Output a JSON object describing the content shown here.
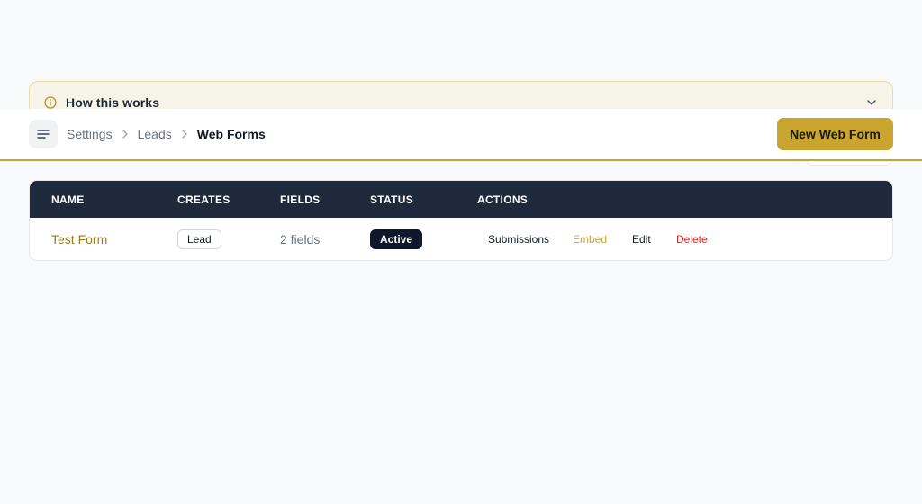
{
  "info_panel": {
    "title": "How this works",
    "icon": "info-icon",
    "chevron": "chevron-down-icon"
  },
  "header": {
    "menu_icon": "menu-icon",
    "breadcrumb": [
      {
        "label": "Settings"
      },
      {
        "label": "Leads"
      },
      {
        "label": "Web Forms"
      }
    ],
    "new_button_label": "New Web Form"
  },
  "table": {
    "columns": [
      "NAME",
      "CREATES",
      "FIELDS",
      "STATUS",
      "ACTIONS"
    ],
    "rows": [
      {
        "name": "Test Form",
        "creates": "Lead",
        "fields": "2 fields",
        "status": "Active",
        "actions": [
          "Submissions",
          "Embed",
          "Edit",
          "Delete"
        ]
      }
    ]
  },
  "colors": {
    "accent": "#c9a42e",
    "header_bg": "#1e293b",
    "danger": "#dc2626",
    "status_active_bg": "#0f172a"
  }
}
